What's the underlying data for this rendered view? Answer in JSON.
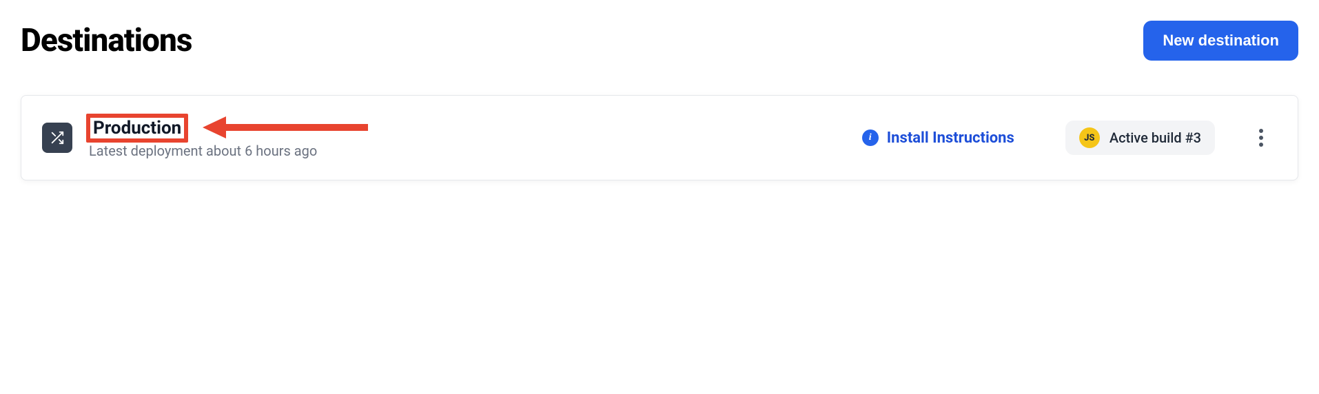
{
  "header": {
    "title": "Destinations",
    "new_button_label": "New destination"
  },
  "destination": {
    "name": "Production",
    "meta": "Latest deployment about 6 hours ago",
    "install_instructions_label": "Install Instructions",
    "active_build": {
      "badge": "JS",
      "label": "Active build #3"
    }
  }
}
